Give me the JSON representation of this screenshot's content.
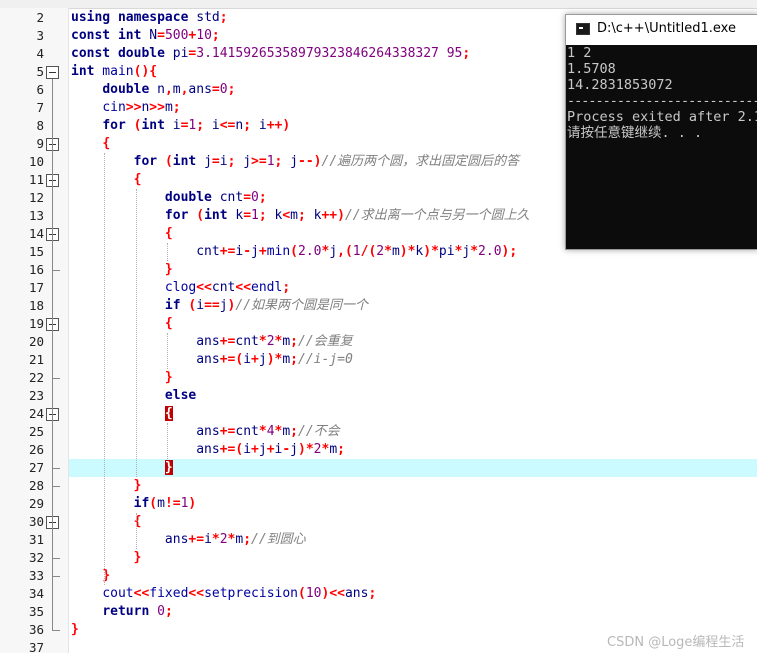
{
  "editor": {
    "line_numbers": [
      "2",
      "3",
      "4",
      "5",
      "6",
      "7",
      "8",
      "9",
      "10",
      "11",
      "12",
      "13",
      "14",
      "15",
      "16",
      "17",
      "18",
      "19",
      "20",
      "21",
      "22",
      "23",
      "24",
      "25",
      "26",
      "27",
      "28",
      "29",
      "30",
      "31",
      "32",
      "33",
      "34",
      "35",
      "36",
      "37"
    ],
    "highlighted_line": "27"
  },
  "code": {
    "l2": [
      {
        "t": "using",
        "c": "kw"
      },
      {
        "t": " "
      },
      {
        "t": "namespace",
        "c": "kw"
      },
      {
        "t": " std",
        "c": "id"
      },
      {
        "t": ";",
        "c": "op"
      }
    ],
    "l3": [
      {
        "t": "const",
        "c": "kw"
      },
      {
        "t": " "
      },
      {
        "t": "int",
        "c": "kw"
      },
      {
        "t": " N",
        "c": "id"
      },
      {
        "t": "=",
        "c": "op"
      },
      {
        "t": "500",
        "c": "num"
      },
      {
        "t": "+",
        "c": "op"
      },
      {
        "t": "10",
        "c": "num"
      },
      {
        "t": ";",
        "c": "op"
      }
    ],
    "l4": [
      {
        "t": "const",
        "c": "kw"
      },
      {
        "t": " "
      },
      {
        "t": "double",
        "c": "kw"
      },
      {
        "t": " pi",
        "c": "id"
      },
      {
        "t": "=",
        "c": "op"
      },
      {
        "t": "3.14159265358979323846264338327 95",
        "c": "num"
      },
      {
        "t": ";",
        "c": "op"
      }
    ],
    "l5": [
      {
        "t": "int",
        "c": "kw"
      },
      {
        "t": " main",
        "c": "fn"
      },
      {
        "t": "(){",
        "c": "br"
      }
    ],
    "l6": [
      {
        "t": "    "
      },
      {
        "t": "double",
        "c": "kw"
      },
      {
        "t": " n",
        "c": "id"
      },
      {
        "t": ",",
        "c": "op"
      },
      {
        "t": "m",
        "c": "id"
      },
      {
        "t": ",",
        "c": "op"
      },
      {
        "t": "ans",
        "c": "id"
      },
      {
        "t": "=",
        "c": "op"
      },
      {
        "t": "0",
        "c": "num"
      },
      {
        "t": ";",
        "c": "op"
      }
    ],
    "l7": [
      {
        "t": "    "
      },
      {
        "t": "cin",
        "c": "fn"
      },
      {
        "t": ">>",
        "c": "op"
      },
      {
        "t": "n",
        "c": "id"
      },
      {
        "t": ">>",
        "c": "op"
      },
      {
        "t": "m",
        "c": "id"
      },
      {
        "t": ";",
        "c": "op"
      }
    ],
    "l8": [
      {
        "t": "    "
      },
      {
        "t": "for",
        "c": "kw"
      },
      {
        "t": " "
      },
      {
        "t": "(",
        "c": "br"
      },
      {
        "t": "int",
        "c": "kw"
      },
      {
        "t": " i",
        "c": "id"
      },
      {
        "t": "=",
        "c": "op"
      },
      {
        "t": "1",
        "c": "num"
      },
      {
        "t": ";",
        "c": "op"
      },
      {
        "t": " i",
        "c": "id"
      },
      {
        "t": "<=",
        "c": "op"
      },
      {
        "t": "n",
        "c": "id"
      },
      {
        "t": ";",
        "c": "op"
      },
      {
        "t": " i",
        "c": "id"
      },
      {
        "t": "++",
        "c": "op"
      },
      {
        "t": ")",
        "c": "br"
      }
    ],
    "l9": [
      {
        "t": "    "
      },
      {
        "t": "{",
        "c": "br"
      }
    ],
    "l10": [
      {
        "t": "        "
      },
      {
        "t": "for",
        "c": "kw"
      },
      {
        "t": " "
      },
      {
        "t": "(",
        "c": "br"
      },
      {
        "t": "int",
        "c": "kw"
      },
      {
        "t": " j",
        "c": "id"
      },
      {
        "t": "=",
        "c": "op"
      },
      {
        "t": "i",
        "c": "id"
      },
      {
        "t": ";",
        "c": "op"
      },
      {
        "t": " j",
        "c": "id"
      },
      {
        "t": ">=",
        "c": "op"
      },
      {
        "t": "1",
        "c": "num"
      },
      {
        "t": ";",
        "c": "op"
      },
      {
        "t": " j",
        "c": "id"
      },
      {
        "t": "--",
        "c": "op"
      },
      {
        "t": ")",
        "c": "br"
      },
      {
        "t": "//遍历两个圆，求出固定圆后的答",
        "c": "cmt"
      }
    ],
    "l11": [
      {
        "t": "        "
      },
      {
        "t": "{",
        "c": "br"
      }
    ],
    "l12": [
      {
        "t": "            "
      },
      {
        "t": "double",
        "c": "kw"
      },
      {
        "t": " cnt",
        "c": "id"
      },
      {
        "t": "=",
        "c": "op"
      },
      {
        "t": "0",
        "c": "num"
      },
      {
        "t": ";",
        "c": "op"
      }
    ],
    "l13": [
      {
        "t": "            "
      },
      {
        "t": "for",
        "c": "kw"
      },
      {
        "t": " "
      },
      {
        "t": "(",
        "c": "br"
      },
      {
        "t": "int",
        "c": "kw"
      },
      {
        "t": " k",
        "c": "id"
      },
      {
        "t": "=",
        "c": "op"
      },
      {
        "t": "1",
        "c": "num"
      },
      {
        "t": ";",
        "c": "op"
      },
      {
        "t": " k",
        "c": "id"
      },
      {
        "t": "<",
        "c": "op"
      },
      {
        "t": "m",
        "c": "id"
      },
      {
        "t": ";",
        "c": "op"
      },
      {
        "t": " k",
        "c": "id"
      },
      {
        "t": "++",
        "c": "op"
      },
      {
        "t": ")",
        "c": "br"
      },
      {
        "t": "//求出离一个点与另一个圆上久",
        "c": "cmt"
      }
    ],
    "l14": [
      {
        "t": "            "
      },
      {
        "t": "{",
        "c": "br"
      }
    ],
    "l15": [
      {
        "t": "                "
      },
      {
        "t": "cnt",
        "c": "id"
      },
      {
        "t": "+=",
        "c": "op"
      },
      {
        "t": "i",
        "c": "id"
      },
      {
        "t": "-",
        "c": "op"
      },
      {
        "t": "j",
        "c": "id"
      },
      {
        "t": "+",
        "c": "op"
      },
      {
        "t": "min",
        "c": "fn"
      },
      {
        "t": "(",
        "c": "br"
      },
      {
        "t": "2.0",
        "c": "num"
      },
      {
        "t": "*",
        "c": "op"
      },
      {
        "t": "j",
        "c": "id"
      },
      {
        "t": ",",
        "c": "op"
      },
      {
        "t": "(",
        "c": "br"
      },
      {
        "t": "1",
        "c": "num"
      },
      {
        "t": "/",
        "c": "op"
      },
      {
        "t": "(",
        "c": "br"
      },
      {
        "t": "2",
        "c": "num"
      },
      {
        "t": "*",
        "c": "op"
      },
      {
        "t": "m",
        "c": "id"
      },
      {
        "t": ")",
        "c": "br"
      },
      {
        "t": "*",
        "c": "op"
      },
      {
        "t": "k",
        "c": "id"
      },
      {
        "t": ")",
        "c": "br"
      },
      {
        "t": "*",
        "c": "op"
      },
      {
        "t": "pi",
        "c": "id"
      },
      {
        "t": "*",
        "c": "op"
      },
      {
        "t": "j",
        "c": "id"
      },
      {
        "t": "*",
        "c": "op"
      },
      {
        "t": "2.0",
        "c": "num"
      },
      {
        "t": ");",
        "c": "br"
      }
    ],
    "l16": [
      {
        "t": "            "
      },
      {
        "t": "}",
        "c": "br"
      }
    ],
    "l17": [
      {
        "t": "            "
      },
      {
        "t": "clog",
        "c": "fn"
      },
      {
        "t": "<<",
        "c": "op"
      },
      {
        "t": "cnt",
        "c": "id"
      },
      {
        "t": "<<",
        "c": "op"
      },
      {
        "t": "endl",
        "c": "fn"
      },
      {
        "t": ";",
        "c": "op"
      }
    ],
    "l18": [
      {
        "t": "            "
      },
      {
        "t": "if",
        "c": "kw"
      },
      {
        "t": " "
      },
      {
        "t": "(",
        "c": "br"
      },
      {
        "t": "i",
        "c": "id"
      },
      {
        "t": "==",
        "c": "op"
      },
      {
        "t": "j",
        "c": "id"
      },
      {
        "t": ")",
        "c": "br"
      },
      {
        "t": "//如果两个圆是同一个",
        "c": "cmt"
      }
    ],
    "l19": [
      {
        "t": "            "
      },
      {
        "t": "{",
        "c": "br"
      }
    ],
    "l20": [
      {
        "t": "                "
      },
      {
        "t": "ans",
        "c": "id"
      },
      {
        "t": "+=",
        "c": "op"
      },
      {
        "t": "cnt",
        "c": "id"
      },
      {
        "t": "*",
        "c": "op"
      },
      {
        "t": "2",
        "c": "num"
      },
      {
        "t": "*",
        "c": "op"
      },
      {
        "t": "m",
        "c": "id"
      },
      {
        "t": ";",
        "c": "op"
      },
      {
        "t": "//会重复",
        "c": "cmt"
      }
    ],
    "l21": [
      {
        "t": "                "
      },
      {
        "t": "ans",
        "c": "id"
      },
      {
        "t": "+=",
        "c": "op"
      },
      {
        "t": "(",
        "c": "br"
      },
      {
        "t": "i",
        "c": "id"
      },
      {
        "t": "+",
        "c": "op"
      },
      {
        "t": "j",
        "c": "id"
      },
      {
        "t": ")",
        "c": "br"
      },
      {
        "t": "*",
        "c": "op"
      },
      {
        "t": "m",
        "c": "id"
      },
      {
        "t": ";",
        "c": "op"
      },
      {
        "t": "//i-j=0",
        "c": "cmt"
      }
    ],
    "l22": [
      {
        "t": "            "
      },
      {
        "t": "}",
        "c": "br"
      }
    ],
    "l23": [
      {
        "t": "            "
      },
      {
        "t": "else",
        "c": "kw"
      }
    ],
    "l24": [
      {
        "t": "            "
      },
      {
        "t": "{",
        "c": "match"
      }
    ],
    "l25": [
      {
        "t": "                "
      },
      {
        "t": "ans",
        "c": "id"
      },
      {
        "t": "+=",
        "c": "op"
      },
      {
        "t": "cnt",
        "c": "id"
      },
      {
        "t": "*",
        "c": "op"
      },
      {
        "t": "4",
        "c": "num"
      },
      {
        "t": "*",
        "c": "op"
      },
      {
        "t": "m",
        "c": "id"
      },
      {
        "t": ";",
        "c": "op"
      },
      {
        "t": "//不会",
        "c": "cmt"
      }
    ],
    "l26": [
      {
        "t": "                "
      },
      {
        "t": "ans",
        "c": "id"
      },
      {
        "t": "+=",
        "c": "op"
      },
      {
        "t": "(",
        "c": "br"
      },
      {
        "t": "i",
        "c": "id"
      },
      {
        "t": "+",
        "c": "op"
      },
      {
        "t": "j",
        "c": "id"
      },
      {
        "t": "+",
        "c": "op"
      },
      {
        "t": "i",
        "c": "id"
      },
      {
        "t": "-",
        "c": "op"
      },
      {
        "t": "j",
        "c": "id"
      },
      {
        "t": ")",
        "c": "br"
      },
      {
        "t": "*",
        "c": "op"
      },
      {
        "t": "2",
        "c": "num"
      },
      {
        "t": "*",
        "c": "op"
      },
      {
        "t": "m",
        "c": "id"
      },
      {
        "t": ";",
        "c": "op"
      }
    ],
    "l27": [
      {
        "t": "            "
      },
      {
        "t": "}",
        "c": "match"
      }
    ],
    "l28": [
      {
        "t": "        "
      },
      {
        "t": "}",
        "c": "br"
      }
    ],
    "l29": [
      {
        "t": "        "
      },
      {
        "t": "if",
        "c": "kw"
      },
      {
        "t": "(",
        "c": "br"
      },
      {
        "t": "m",
        "c": "id"
      },
      {
        "t": "!=",
        "c": "op"
      },
      {
        "t": "1",
        "c": "num"
      },
      {
        "t": ")",
        "c": "br"
      }
    ],
    "l30": [
      {
        "t": "        "
      },
      {
        "t": "{",
        "c": "br"
      }
    ],
    "l31": [
      {
        "t": "            "
      },
      {
        "t": "ans",
        "c": "id"
      },
      {
        "t": "+=",
        "c": "op"
      },
      {
        "t": "i",
        "c": "id"
      },
      {
        "t": "*",
        "c": "op"
      },
      {
        "t": "2",
        "c": "num"
      },
      {
        "t": "*",
        "c": "op"
      },
      {
        "t": "m",
        "c": "id"
      },
      {
        "t": ";",
        "c": "op"
      },
      {
        "t": "//到圆心",
        "c": "cmt"
      }
    ],
    "l32": [
      {
        "t": "        "
      },
      {
        "t": "}",
        "c": "br"
      }
    ],
    "l33": [
      {
        "t": "    "
      },
      {
        "t": "}",
        "c": "br"
      }
    ],
    "l34": [
      {
        "t": "    "
      },
      {
        "t": "cout",
        "c": "fn"
      },
      {
        "t": "<<",
        "c": "op"
      },
      {
        "t": "fixed",
        "c": "fn"
      },
      {
        "t": "<<",
        "c": "op"
      },
      {
        "t": "setprecision",
        "c": "fn"
      },
      {
        "t": "(",
        "c": "br"
      },
      {
        "t": "10",
        "c": "num"
      },
      {
        "t": ")",
        "c": "br"
      },
      {
        "t": "<<",
        "c": "op"
      },
      {
        "t": "ans",
        "c": "id"
      },
      {
        "t": ";",
        "c": "op"
      }
    ],
    "l35": [
      {
        "t": "    "
      },
      {
        "t": "return",
        "c": "kw"
      },
      {
        "t": " "
      },
      {
        "t": "0",
        "c": "num"
      },
      {
        "t": ";",
        "c": "op"
      }
    ],
    "l36": [
      {
        "t": "}",
        "c": "br"
      }
    ],
    "l37": []
  },
  "console": {
    "title": "D:\\c++\\Untitled1.exe",
    "lines": [
      "1 2",
      "1.5708",
      "14.2831853072",
      "--------------------------------",
      "Process exited after 2.1",
      "请按任意键继续. . ."
    ]
  },
  "watermark": "CSDN @Loge编程生活",
  "colors": {
    "keyword": "#000080",
    "operator": "#ff0000",
    "number": "#800080",
    "comment": "#808080",
    "highlight_line": "#ccfbff",
    "bracket_match": "#c00000",
    "console_bg": "#0c0c0c"
  }
}
